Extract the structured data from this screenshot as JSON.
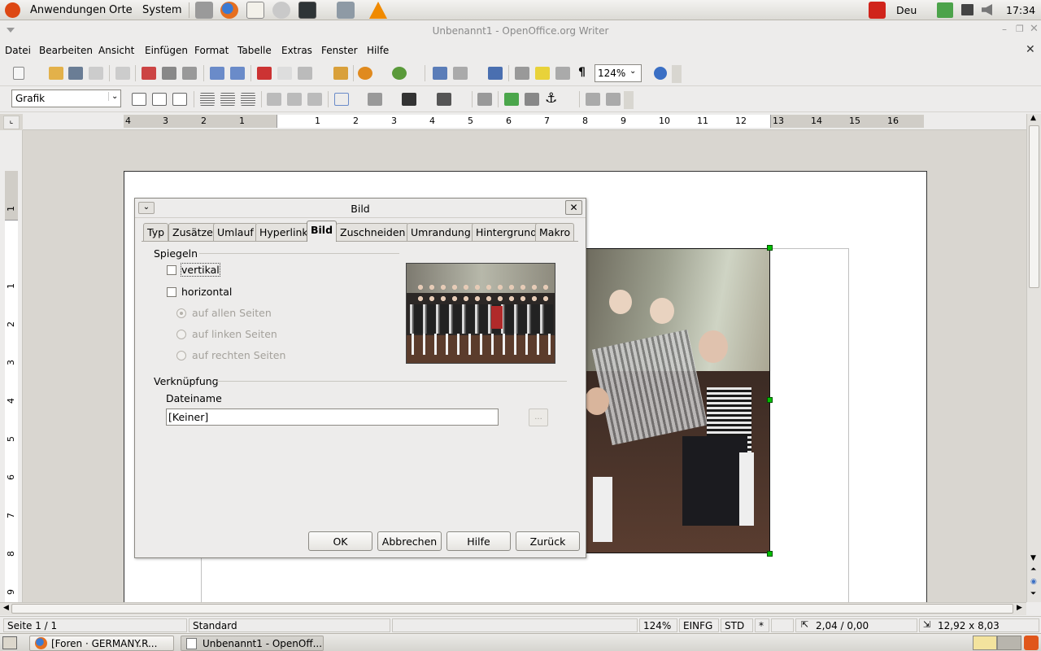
{
  "top_panel": {
    "menus": [
      "Anwendungen",
      "Orte",
      "System"
    ],
    "launchers": [
      "settings-icon",
      "firefox-icon",
      "text-editor-icon",
      "help-icon",
      "terminal-icon",
      "network-icon",
      "vlc-icon"
    ],
    "keyboard_layout": "Deu",
    "clock": "17:34"
  },
  "window": {
    "title": "Unbenannt1 - OpenOffice.org Writer"
  },
  "menu_bar": [
    "Datei",
    "Bearbeiten",
    "Ansicht",
    "Einfügen",
    "Format",
    "Tabelle",
    "Extras",
    "Fenster",
    "Hilfe"
  ],
  "standard_toolbar": {
    "zoom": "124%"
  },
  "format_toolbar": {
    "style": "Grafik"
  },
  "ruler": {
    "h_ticks": [
      "4",
      "3",
      "2",
      "1",
      "1",
      "2",
      "3",
      "4",
      "5",
      "6",
      "7",
      "8",
      "9",
      "10",
      "11",
      "12",
      "13",
      "14",
      "15",
      "16"
    ],
    "v_ticks": [
      "1",
      "1",
      "2",
      "3",
      "4",
      "5",
      "6",
      "7",
      "8",
      "9"
    ]
  },
  "dialog": {
    "title": "Bild",
    "tabs": [
      "Typ",
      "Zusätze",
      "Umlauf",
      "Hyperlink",
      "Bild",
      "Zuschneiden",
      "Umrandung",
      "Hintergrund",
      "Makro"
    ],
    "active_tab": "Bild",
    "mirror": {
      "label": "Spiegeln",
      "vertical": "vertikal",
      "horizontal": "horizontal",
      "all_pages": "auf allen Seiten",
      "left_pages": "auf linken Seiten",
      "right_pages": "auf rechten Seiten"
    },
    "link": {
      "label": "Verknüpfung",
      "filename_label": "Dateiname",
      "filename_value": "[Keiner]",
      "browse": "..."
    },
    "buttons": {
      "ok": "OK",
      "cancel": "Abbrechen",
      "help": "Hilfe",
      "back": "Zurück"
    }
  },
  "status_bar": {
    "page": "Seite 1 / 1",
    "style": "Standard",
    "zoom": "124%",
    "insert_mode": "EINFG",
    "selection_mode": "STD",
    "modified": "*",
    "position": "2,04 / 0,00",
    "size": "12,92 x 8,03"
  },
  "task_bar": {
    "tasks": [
      "[Foren · GERMANY.R...",
      "Unbenannt1 - OpenOff..."
    ]
  },
  "colors": {
    "accent_orange": "#e07020",
    "selection_handle": "#00c000"
  }
}
